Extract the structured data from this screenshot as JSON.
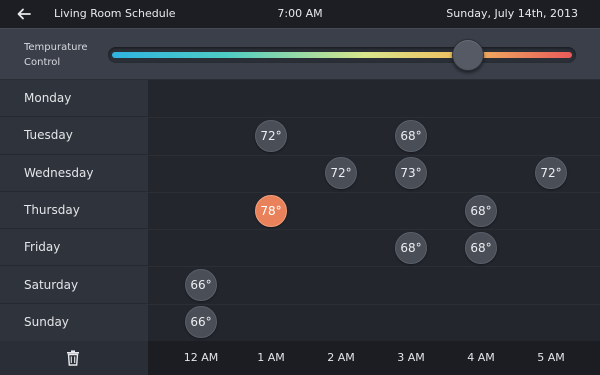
{
  "header": {
    "title": "Living Room Schedule",
    "time": "7:00 AM",
    "date": "Sunday,  July 14th, 2013"
  },
  "temperature_control": {
    "label": "Tempurature Control",
    "level_fraction": 0.77
  },
  "days": [
    "Monday",
    "Tuesday",
    "Wednesday",
    "Thursday",
    "Friday",
    "Saturday",
    "Sunday"
  ],
  "hours": [
    "12  AM",
    "1 AM",
    "2 AM",
    "3 AM",
    "4 AM",
    "5 AM"
  ],
  "schedule": [
    {
      "day": 1,
      "hour": 1,
      "label": "72°",
      "hot": false
    },
    {
      "day": 1,
      "hour": 3,
      "label": "68°",
      "hot": false
    },
    {
      "day": 2,
      "hour": 2,
      "label": "72°",
      "hot": false
    },
    {
      "day": 2,
      "hour": 3,
      "label": "73°",
      "hot": false
    },
    {
      "day": 2,
      "hour": 5,
      "label": "72°",
      "hot": false
    },
    {
      "day": 3,
      "hour": 1,
      "label": "78°",
      "hot": true
    },
    {
      "day": 3,
      "hour": 4,
      "label": "68°",
      "hot": false
    },
    {
      "day": 4,
      "hour": 3,
      "label": "68°",
      "hot": false
    },
    {
      "day": 4,
      "hour": 4,
      "label": "68°",
      "hot": false
    },
    {
      "day": 5,
      "hour": 0,
      "label": "66°",
      "hot": false
    },
    {
      "day": 6,
      "hour": 0,
      "label": "66°",
      "hot": false
    }
  ],
  "icons": {
    "back": "back-arrow-icon",
    "delete": "trash-icon"
  },
  "colors": {
    "hot_accent": "#e9825a",
    "slot_default": "#4a4e57"
  }
}
